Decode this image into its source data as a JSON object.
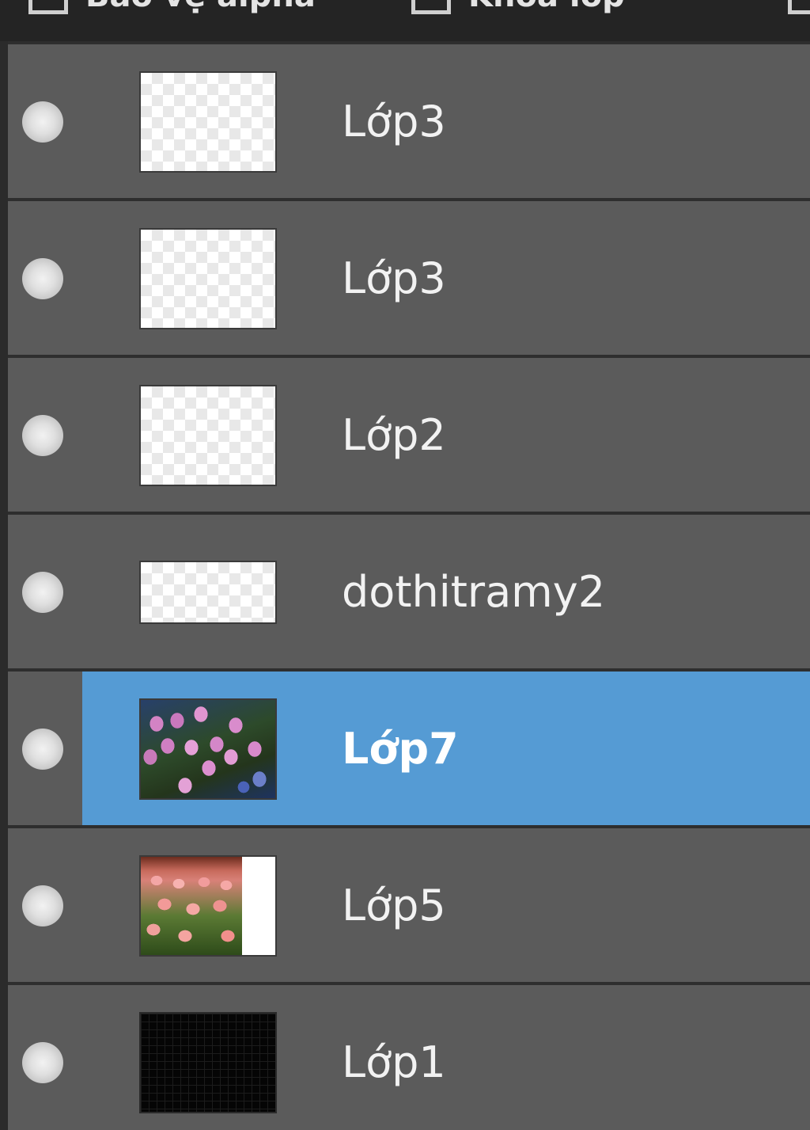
{
  "toolbar": {
    "options": [
      {
        "label": "Bảo vệ alpha"
      },
      {
        "label": "Khóa lớp"
      },
      {
        "label": ""
      }
    ]
  },
  "layers": [
    {
      "name": "Lớp3",
      "thumbnail": "transparent-checker",
      "selected": false
    },
    {
      "name": "Lớp3",
      "thumbnail": "transparent-checker",
      "selected": false
    },
    {
      "name": "Lớp2",
      "thumbnail": "transparent-checker",
      "selected": false
    },
    {
      "name": "dothitramy2",
      "thumbnail": "transparent-checker-wide",
      "selected": false
    },
    {
      "name": "Lớp7",
      "thumbnail": "purple-tulips-photo",
      "selected": true
    },
    {
      "name": "Lớp5",
      "thumbnail": "pink-tulips-photo",
      "selected": false
    },
    {
      "name": "Lớp1",
      "thumbnail": "black-fill",
      "selected": false
    }
  ],
  "colors": {
    "panel_background": "#5b5b5b",
    "selection_highlight": "#559bd4",
    "separator": "#2e2e2e",
    "topbar": "#242424"
  }
}
